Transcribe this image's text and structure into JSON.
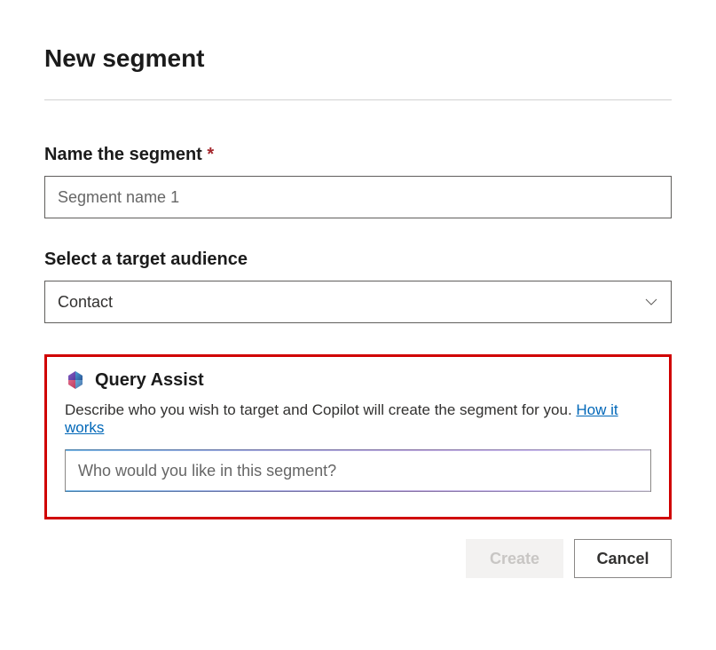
{
  "page": {
    "title": "New segment"
  },
  "nameField": {
    "label": "Name the segment",
    "required": "*",
    "placeholder": "Segment name 1",
    "value": ""
  },
  "audienceField": {
    "label": "Select a target audience",
    "selected": "Contact"
  },
  "queryAssist": {
    "title": "Query Assist",
    "description": "Describe who you wish to target and Copilot will create the segment for you. ",
    "linkText": "How it works",
    "placeholder": "Who would you like in this segment?"
  },
  "buttons": {
    "create": "Create",
    "cancel": "Cancel"
  }
}
